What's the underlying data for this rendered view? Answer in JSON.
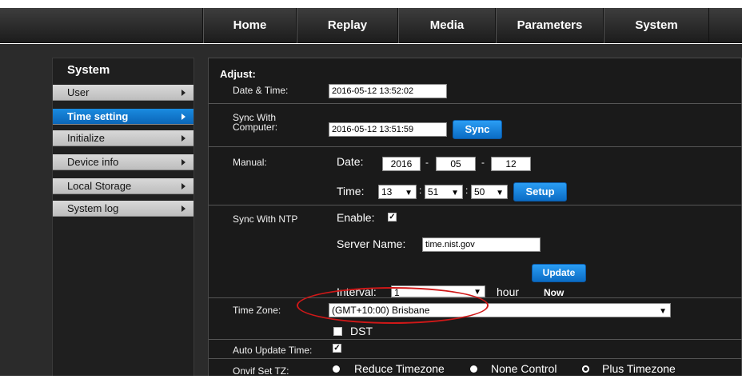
{
  "topnav": {
    "tabs": [
      "Home",
      "Replay",
      "Media",
      "Parameters",
      "System"
    ]
  },
  "sidebar": {
    "title": "System",
    "items": [
      {
        "label": "User",
        "active": false
      },
      {
        "label": "Time setting",
        "active": true
      },
      {
        "label": "Initialize",
        "active": false
      },
      {
        "label": "Device info",
        "active": false
      },
      {
        "label": "Local Storage",
        "active": false
      },
      {
        "label": "System log",
        "active": false
      }
    ]
  },
  "adjust": {
    "heading": "Adjust:",
    "datetime_label": "Date & Time:",
    "datetime_value": "2016-05-12 13:52:02",
    "sync_label_line1": "Sync With",
    "sync_label_line2": "Computer:",
    "sync_value": "2016-05-12 13:51:59",
    "sync_button": "Sync"
  },
  "manual": {
    "label": "Manual:",
    "date_label": "Date:",
    "year": "2016",
    "month": "05",
    "day": "12",
    "dash": "-",
    "time_label": "Time:",
    "hour": "13",
    "minute": "51",
    "second": "50",
    "colon": ":",
    "setup_button": "Setup"
  },
  "ntp": {
    "label": "Sync With NTP",
    "enable_label": "Enable:",
    "enable_checked": true,
    "server_label": "Server Name:",
    "server_value": "time.nist.gov",
    "update_button": "Update",
    "interval_label": "Interval:",
    "interval_value": "1",
    "interval_unit": "hour",
    "now_label": "Now"
  },
  "timezone": {
    "label": "Time Zone:",
    "value": "(GMT+10:00) Brisbane",
    "dst_label": "DST",
    "dst_checked": false
  },
  "auto_update": {
    "label": "Auto Update Time:",
    "checked": true
  },
  "onvif": {
    "label": "Onvif Set TZ:",
    "options": [
      "Reduce Timezone",
      "None Control",
      "Plus Timezone"
    ],
    "selected_index": 2
  },
  "icons": {
    "check": "✓",
    "chevron": "⌄"
  },
  "colors": {
    "accent_blue": "#0b66b8",
    "highlight_red": "#d01818"
  }
}
